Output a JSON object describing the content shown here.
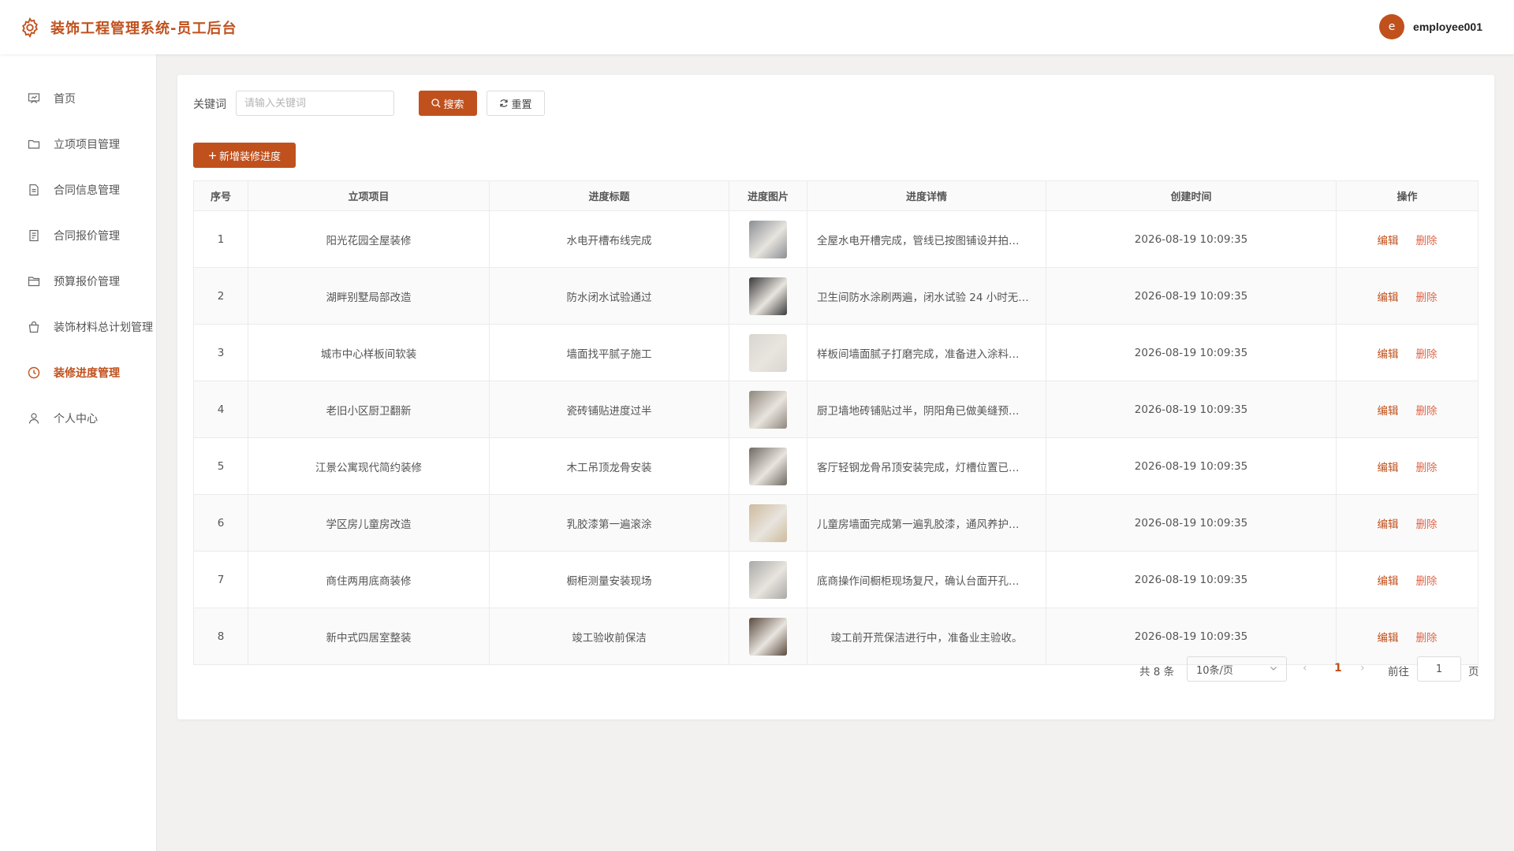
{
  "header": {
    "title": "装饰工程管理系统-员工后台",
    "avatar_letter": "e",
    "username": "employee001"
  },
  "sidebar": {
    "items": [
      {
        "label": "首页",
        "icon": "presentation-icon",
        "active": false
      },
      {
        "label": "立项项目管理",
        "icon": "folder-icon",
        "active": false
      },
      {
        "label": "合同信息管理",
        "icon": "document-icon",
        "active": false
      },
      {
        "label": "合同报价管理",
        "icon": "document-list-icon",
        "active": false
      },
      {
        "label": "预算报价管理",
        "icon": "folder-open-icon",
        "active": false
      },
      {
        "label": "装饰材料总计划管理",
        "icon": "shopping-bag-icon",
        "active": false
      },
      {
        "label": "装修进度管理",
        "icon": "clock-icon",
        "active": true
      },
      {
        "label": "个人中心",
        "icon": "user-icon",
        "active": false
      }
    ]
  },
  "search": {
    "label": "关键词",
    "placeholder": "请输入关键词",
    "value": "",
    "search_label": "搜索",
    "reset_label": "重置"
  },
  "toolbar": {
    "add_label": "新增装修进度"
  },
  "table": {
    "headers": [
      "序号",
      "立项项目",
      "进度标题",
      "进度图片",
      "进度详情",
      "创建时间",
      "操作"
    ],
    "rows": [
      {
        "no": "1",
        "project": "阳光花园全屋装修",
        "title": "水电开槽布线完成",
        "detail": "全屋水电开槽完成，管线已按图铺设并拍…",
        "created": "2026-08-19 10:09:35",
        "thumb_color": "#8a8f94"
      },
      {
        "no": "2",
        "project": "湖畔别墅局部改造",
        "title": "防水闭水试验通过",
        "detail": "卫生间防水涂刷两遍，闭水试验 24 小时无…",
        "created": "2026-08-19 10:09:35",
        "thumb_color": "#3a3a3c"
      },
      {
        "no": "3",
        "project": "城市中心样板间软装",
        "title": "墙面找平腻子施工",
        "detail": "样板间墙面腻子打磨完成，准备进入涂料…",
        "created": "2026-08-19 10:09:35",
        "thumb_color": "#d9d5d0"
      },
      {
        "no": "4",
        "project": "老旧小区厨卫翻新",
        "title": "瓷砖铺贴进度过半",
        "detail": "厨卫墙地砖铺贴过半，阴阳角已做美缝预…",
        "created": "2026-08-19 10:09:35",
        "thumb_color": "#8f877d"
      },
      {
        "no": "5",
        "project": "江景公寓现代简约装修",
        "title": "木工吊顶龙骨安装",
        "detail": "客厅轻钢龙骨吊顶安装完成，灯槽位置已…",
        "created": "2026-08-19 10:09:35",
        "thumb_color": "#6e6a62"
      },
      {
        "no": "6",
        "project": "学区房儿童房改造",
        "title": "乳胶漆第一遍滚涂",
        "detail": "儿童房墙面完成第一遍乳胶漆，通风养护…",
        "created": "2026-08-19 10:09:35",
        "thumb_color": "#cdbb9c"
      },
      {
        "no": "7",
        "project": "商住两用底商装修",
        "title": "橱柜测量安装现场",
        "detail": "底商操作间橱柜现场复尺，确认台面开孔…",
        "created": "2026-08-19 10:09:35",
        "thumb_color": "#a9a9a6"
      },
      {
        "no": "8",
        "project": "新中式四居室整装",
        "title": "竣工验收前保洁",
        "detail": "竣工前开荒保洁进行中，准备业主验收。",
        "created": "2026-08-19 10:09:35",
        "thumb_color": "#5a4a3e"
      }
    ],
    "edit_label": "编辑",
    "delete_label": "删除"
  },
  "pagination": {
    "total_text": "共 8 条",
    "page_size": "10条/页",
    "current_page": "1",
    "goto_label": "前往",
    "goto_value": "1",
    "page_suffix": "页"
  },
  "colors": {
    "accent": "#c0511d",
    "delete": "#e0674a"
  }
}
